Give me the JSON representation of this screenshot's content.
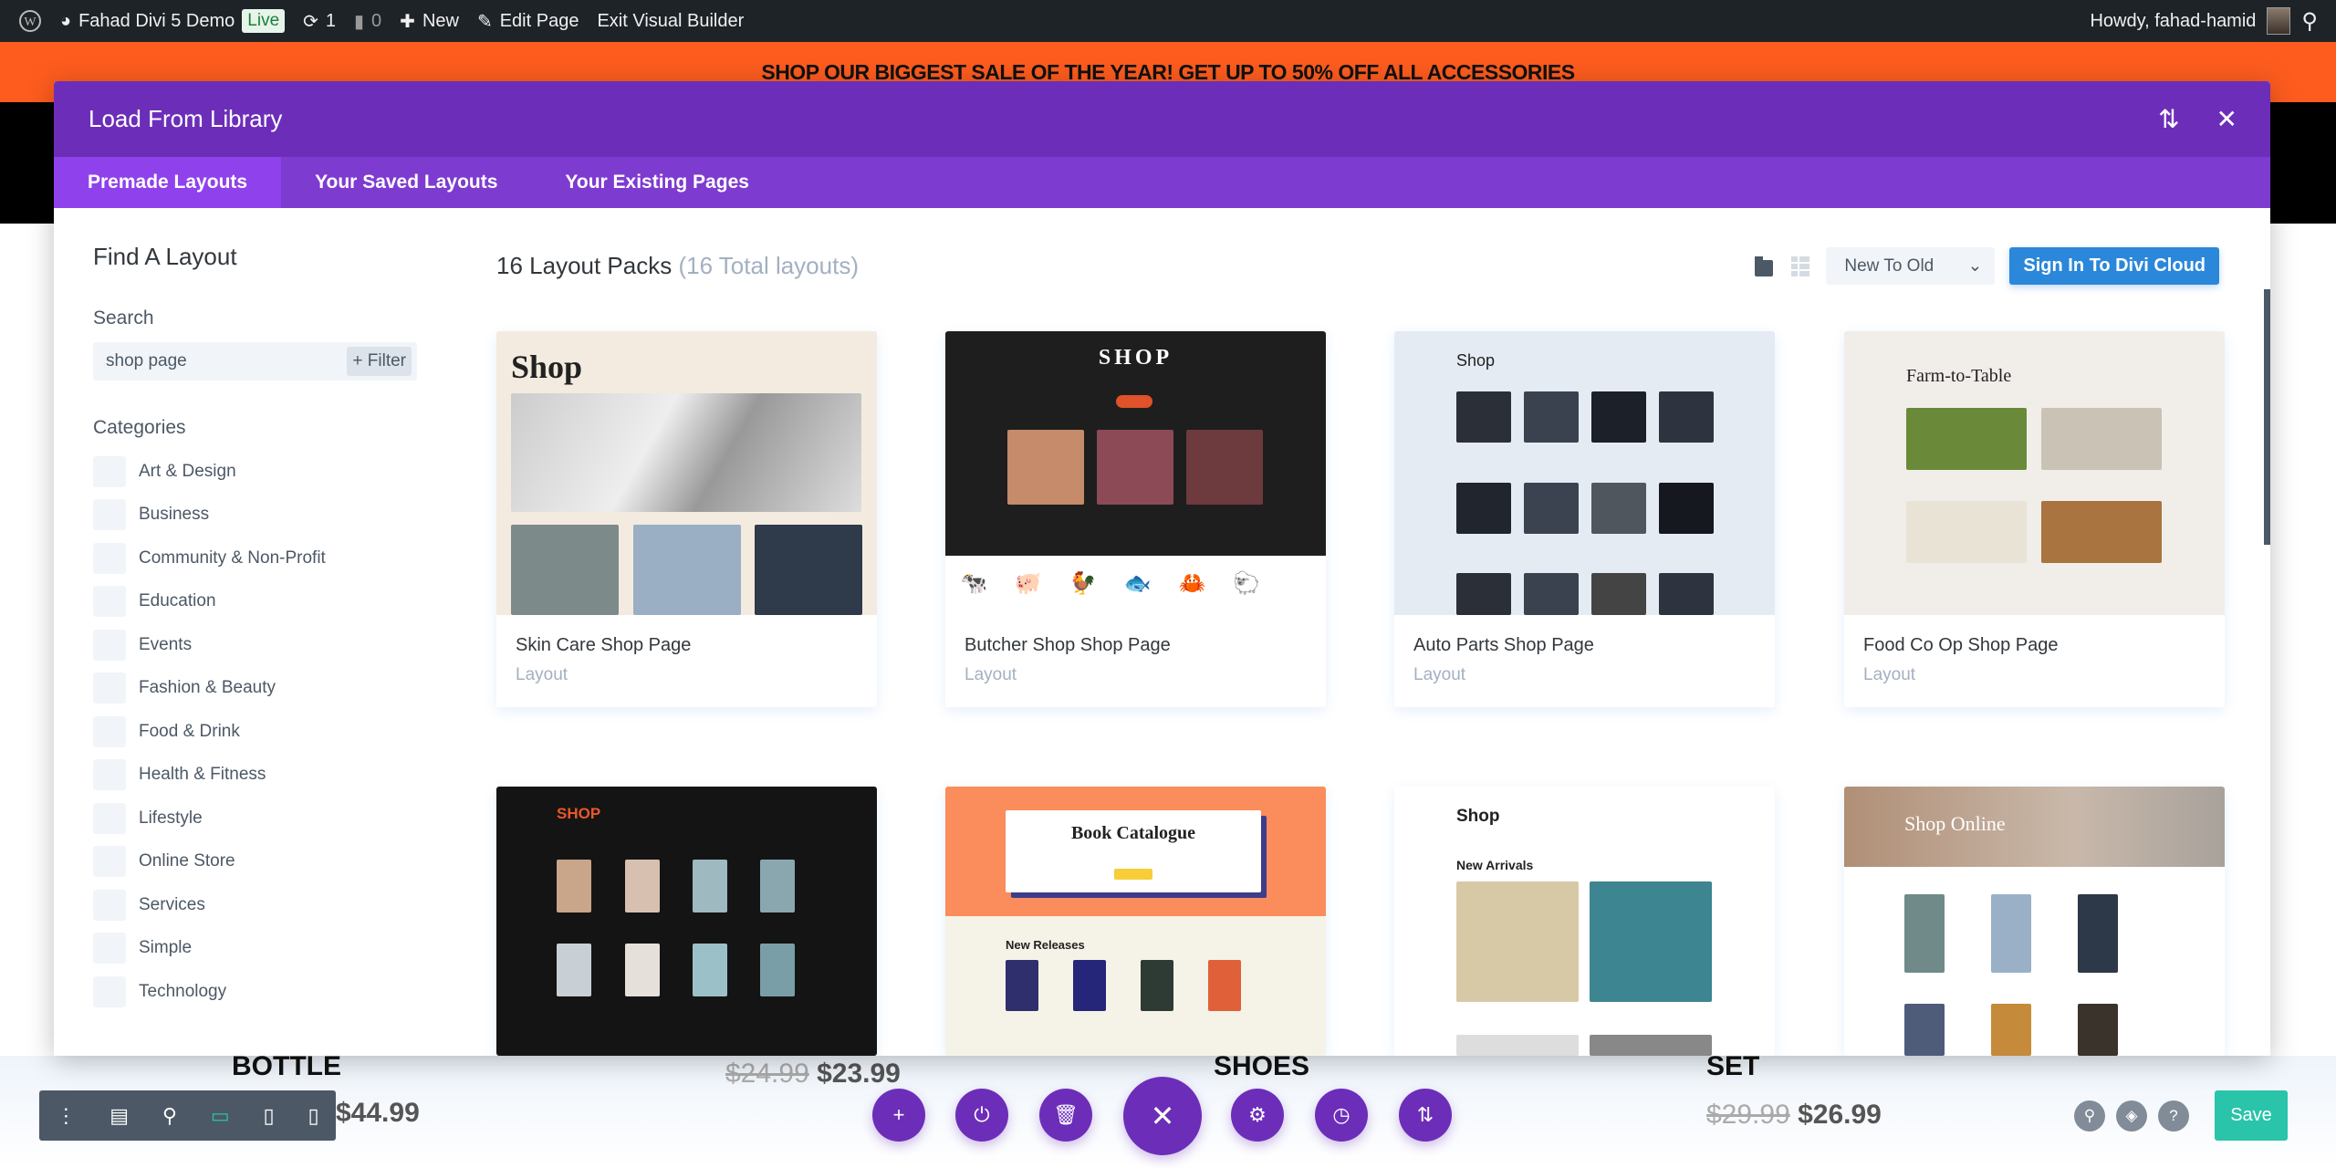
{
  "admin_bar": {
    "site_name": "Fahad Divi 5 Demo",
    "live_badge": "Live",
    "updates_count": "1",
    "comments_count": "0",
    "new_label": "New",
    "edit_page_label": "Edit Page",
    "exit_builder_label": "Exit Visual Builder",
    "greeting": "Howdy, fahad-hamid"
  },
  "banner": {
    "text": "SHOP OUR BIGGEST SALE OF THE YEAR! GET UP TO 50% OFF ALL ACCESSORIES"
  },
  "modal": {
    "title": "Load From Library",
    "tabs": [
      {
        "label": "Premade Layouts",
        "active": true
      },
      {
        "label": "Your Saved Layouts",
        "active": false
      },
      {
        "label": "Your Existing Pages",
        "active": false
      }
    ],
    "sidebar": {
      "heading": "Find A Layout",
      "search_label": "Search",
      "search_value": "shop page",
      "filter_label": "+ Filter",
      "categories_label": "Categories",
      "categories": [
        "Art & Design",
        "Business",
        "Community & Non-Profit",
        "Education",
        "Events",
        "Fashion & Beauty",
        "Food & Drink",
        "Health & Fitness",
        "Lifestyle",
        "Online Store",
        "Services",
        "Simple",
        "Technology"
      ]
    },
    "main": {
      "count_title": "16 Layout Packs",
      "count_subtitle": "(16 Total layouts)",
      "sort_value": "New To Old",
      "signin_label": "Sign In To Divi Cloud",
      "cards": [
        {
          "title": "Skin Care Shop Page",
          "type": "Layout",
          "thumb_heading": "Shop"
        },
        {
          "title": "Butcher Shop Shop Page",
          "type": "Layout",
          "thumb_heading": "SHOP"
        },
        {
          "title": "Auto Parts Shop Page",
          "type": "Layout",
          "thumb_heading": "Shop"
        },
        {
          "title": "Food Co Op Shop Page",
          "type": "Layout",
          "thumb_heading": "Farm-to-Table"
        },
        {
          "thumb_heading": "SHOP"
        },
        {
          "thumb_heading": "Book Catalogue",
          "thumb_subheading": "New Releases"
        },
        {
          "thumb_heading": "Shop",
          "thumb_subheading": "New Arrivals"
        },
        {
          "thumb_heading": "Shop Online"
        }
      ]
    }
  },
  "page": {
    "products": [
      {
        "name": "BOTTLE",
        "price": "$44.99"
      },
      {
        "old_price": "$24.99",
        "price": "$23.99"
      },
      {
        "name": "SHOES"
      },
      {
        "name": "SET",
        "old_price": "$29.99",
        "price": "$26.99"
      }
    ]
  },
  "builder": {
    "save_label": "Save",
    "accent": "#6c2eb9",
    "save_color": "#29c4a9"
  }
}
